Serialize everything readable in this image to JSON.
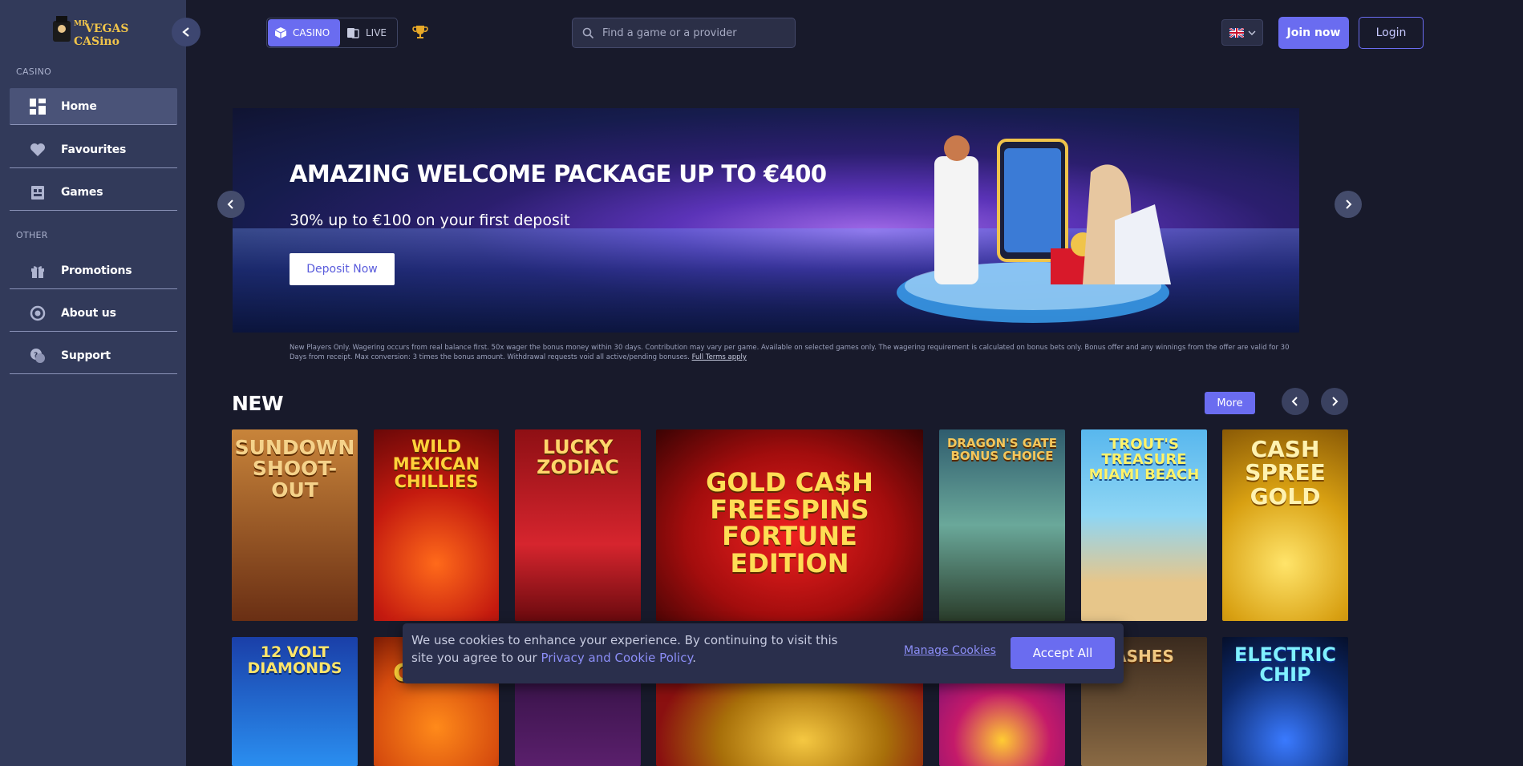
{
  "brand": {
    "logo_text": "MR VEGAS CASINO",
    "accent": "#6a6cf0"
  },
  "sidebar": {
    "section_casino": "CASINO",
    "section_other": "OTHER",
    "items": [
      {
        "label": "Home",
        "icon": "grid-icon"
      },
      {
        "label": "Favourites",
        "icon": "heart-icon"
      },
      {
        "label": "Games",
        "icon": "cards-icon"
      },
      {
        "label": "Promotions",
        "icon": "gift-icon"
      },
      {
        "label": "About us",
        "icon": "circle-icon"
      },
      {
        "label": "Support",
        "icon": "support-icon"
      }
    ]
  },
  "topbar": {
    "tabs": [
      {
        "label": "CASINO",
        "active": true
      },
      {
        "label": "LIVE",
        "active": false
      }
    ],
    "search_placeholder": "Find a game or a provider",
    "language": "UK flag",
    "join_label": "Join now",
    "login_label": "Login"
  },
  "hero": {
    "title": "AMAZING WELCOME PACKAGE UP TO €400",
    "subtitle": "30% up to €100 on your first deposit",
    "cta": "Deposit Now",
    "terms": "New Players Only. Wagering occurs from real balance first. 50x wager the bonus money within 30 days. Contribution may vary per game. Available on selected games only. The wagering requirement is calculated on bonus bets only. Bonus offer and any winnings from the offer are valid for 30 Days from receipt. Max conversion: 3 times the bonus amount. Withdrawal requests void all active/pending bonuses.",
    "terms_link": "Full Terms apply"
  },
  "new_section": {
    "title": "NEW",
    "more_label": "More",
    "games_row1": [
      {
        "title": "SUNDOWN SHOOT-OUT",
        "color": "#b0652a"
      },
      {
        "title": "WILD MEXICAN CHILLIES",
        "color": "#c41a0f"
      },
      {
        "title": "LUCKY ZODIAC",
        "color": "#b5121b"
      },
      {
        "title": "GOLD CA$H FREESPINS FORTUNE EDITION",
        "color": "#a30d0d"
      },
      {
        "title": "DRAGON'S GATE BONUS CHOICE",
        "color": "#3e7c74"
      },
      {
        "title": "TROUT'S TREASURE MIAMI BEACH",
        "color": "#3d9ed6"
      },
      {
        "title": "CASH SPREE GOLD",
        "color": "#d8a012"
      }
    ],
    "games_row2": [
      {
        "title": "12 VOLT DIAMONDS",
        "color": "#1c57c8"
      },
      {
        "title": "CHILLI",
        "color": "#d64c0e"
      },
      {
        "title": "",
        "color": "#4a1f5c"
      },
      {
        "title": "",
        "color": "#8a1010"
      },
      {
        "title": "",
        "color": "#7a1a88"
      },
      {
        "title": "ASHES",
        "color": "#6b4a2a"
      },
      {
        "title": "ELECTRIC CHIP",
        "color": "#0d2a6e"
      }
    ]
  },
  "cookie": {
    "text": "We use cookies to enhance your experience. By continuing to visit this site you agree to our",
    "policy_link": "Privacy and Cookie Policy",
    "manage_label": "Manage Cookies",
    "accept_label": "Accept All"
  }
}
